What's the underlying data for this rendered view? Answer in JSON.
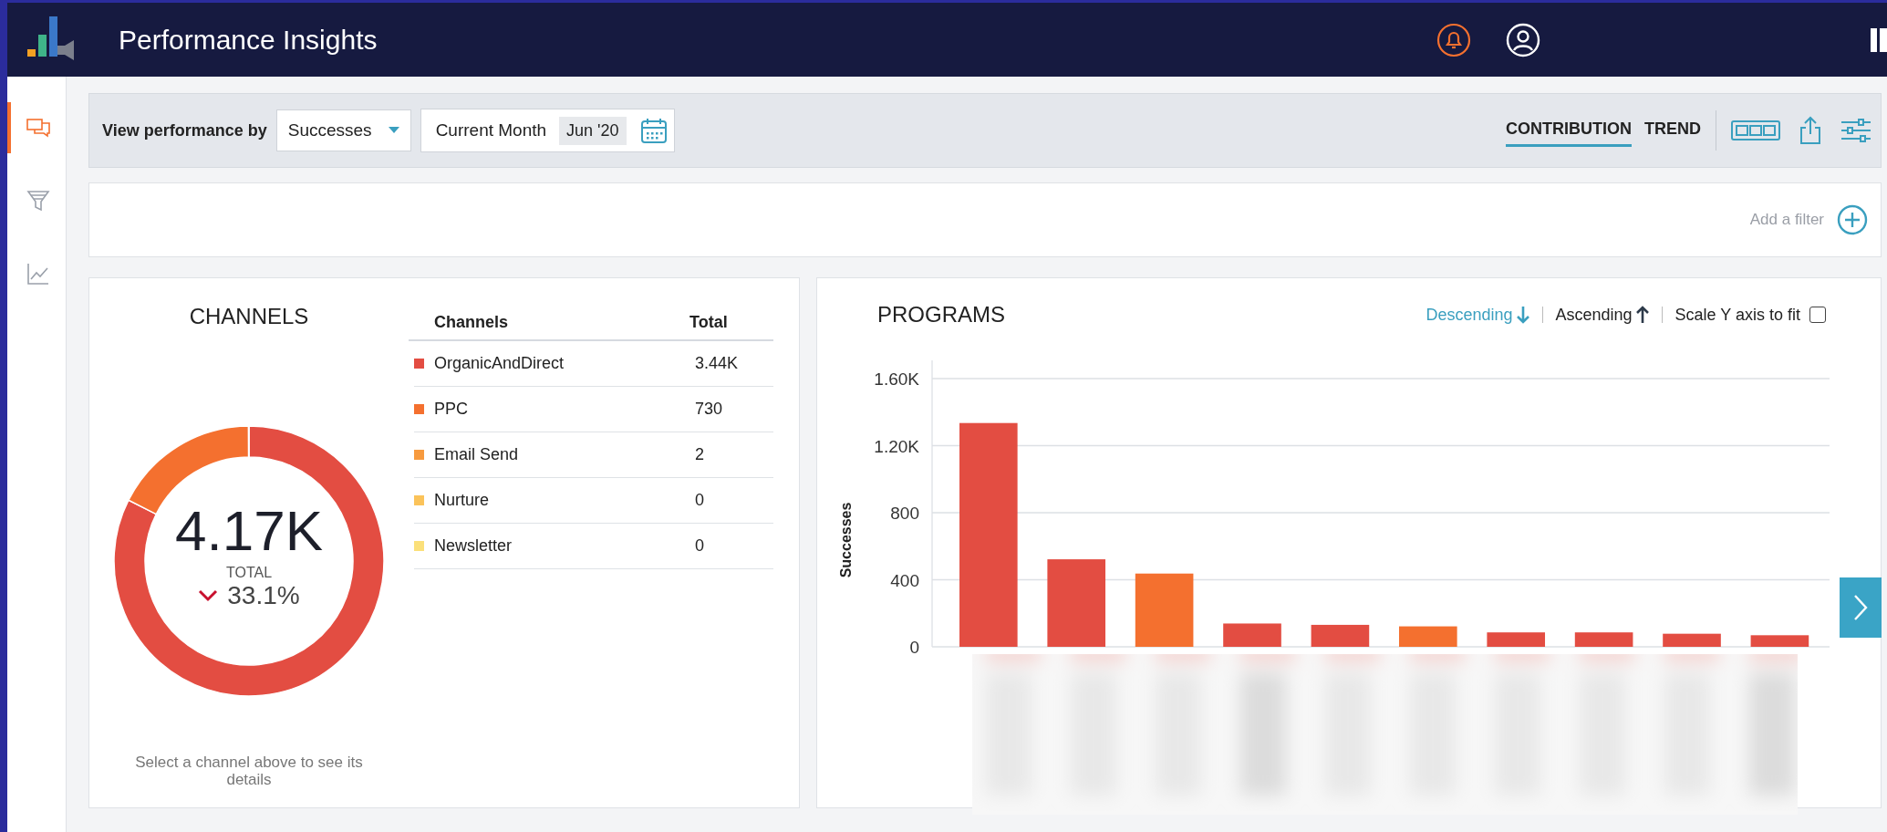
{
  "header": {
    "title": "Performance Insights"
  },
  "sidebar": {
    "items": [
      {
        "kind": "chat",
        "selected": true
      },
      {
        "kind": "funnel",
        "selected": false
      },
      {
        "kind": "trend",
        "selected": false
      }
    ]
  },
  "toolbar": {
    "view_label": "View performance by",
    "metric": "Successes",
    "period_label": "Current Month",
    "period_value": "Jun '20",
    "tabs": [
      {
        "label": "CONTRIBUTION",
        "selected": true
      },
      {
        "label": "TREND",
        "selected": false
      }
    ]
  },
  "filter_bar": {
    "add_label": "Add a filter"
  },
  "channels": {
    "title": "CHANNELS",
    "total": "4.17K",
    "total_label": "TOTAL",
    "change": {
      "text": "33.1%",
      "kind": "decrease"
    },
    "columns": [
      "Channels",
      "Total"
    ],
    "rows": [
      {
        "name": "OrganicAndDirect",
        "total": "3.44K",
        "color": "#e34d42"
      },
      {
        "name": "PPC",
        "total": "730",
        "color": "#f4702f"
      },
      {
        "name": "Email Send",
        "total": "2",
        "color": "#f79a3e"
      },
      {
        "name": "Nurture",
        "total": "0",
        "color": "#fbc35a"
      },
      {
        "name": "Newsletter",
        "total": "0",
        "color": "#fbe07a"
      }
    ],
    "chart_data": {
      "type": "donut",
      "values": [
        82.45,
        17.5,
        0.05,
        0,
        0
      ]
    },
    "hint": "Select a channel above to see its details"
  },
  "programs": {
    "title": "PROGRAMS",
    "sort": [
      {
        "label": "Descending",
        "kind": "descending",
        "selected": true
      },
      {
        "label": "Ascending",
        "kind": "ascending",
        "selected": false
      }
    ],
    "scale_label": "Scale Y axis to fit",
    "scale_checked": false,
    "chart_data": {
      "type": "bar",
      "ylabel": "Successes",
      "stacked": true,
      "grid": true,
      "ylim": [
        0,
        1600
      ],
      "yticks": [
        0,
        400,
        800,
        {
          "value": 1200,
          "label": "1.20K"
        },
        {
          "value": 1600,
          "label": "1.60K"
        }
      ],
      "series": [
        {
          "color": "#e34d42",
          "values": [
            1335,
            522,
            null,
            139,
            131,
            null,
            86,
            86,
            78,
            69
          ]
        },
        {
          "color": "#f4702f",
          "values": [
            null,
            null,
            437,
            null,
            null,
            122,
            null,
            null,
            null,
            null
          ]
        }
      ]
    }
  }
}
